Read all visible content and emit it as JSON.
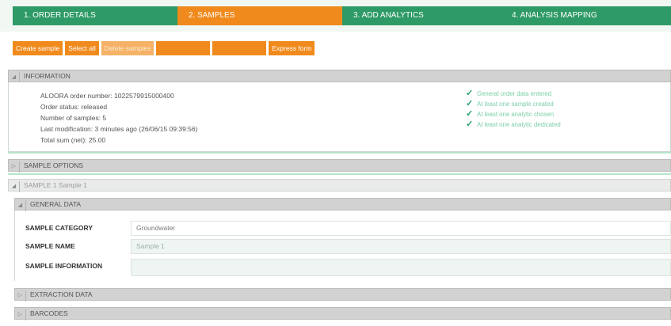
{
  "wizard": {
    "steps": [
      {
        "label": "1. ORDER DETAILS",
        "state": "done"
      },
      {
        "label": "2. SAMPLES",
        "state": "active"
      },
      {
        "label": "3. ADD ANALYTICS",
        "state": "todo"
      },
      {
        "label": "4. ANALYSIS MAPPING",
        "state": "todo"
      }
    ]
  },
  "toolbar": {
    "create": "Create sample",
    "select_all": "Select all",
    "delete": "Delete samples",
    "express": "Express form"
  },
  "information": {
    "title": "INFORMATION",
    "order_number": "ALOORA order number: 1022579915000400",
    "order_status": "Order status: released",
    "num_samples": "Number of samples: 5",
    "last_modification": "Last modification: 3 minutes ago (26/06/15 09:39:56)",
    "total_sum": "Total sum (net): 25.00",
    "checks": [
      "General order data entered",
      "At least one sample created",
      "At least one analytic chosen",
      "At least one analytic dedicated"
    ]
  },
  "sample_options": {
    "title": "SAMPLE OPTIONS"
  },
  "sample1": {
    "title": "SAMPLE 1  Sample 1"
  },
  "general_data": {
    "title": "GENERAL DATA",
    "category_label": "SAMPLE CATEGORY",
    "category_value": "Groundwater",
    "name_label": "SAMPLE NAME",
    "name_value": "Sample 1",
    "info_label": "SAMPLE INFORMATION",
    "info_value": ""
  },
  "extraction": {
    "title": "EXTRACTION DATA"
  },
  "barcodes": {
    "title": "BARCODES"
  },
  "colors": {
    "green": "#2e9a66",
    "orange": "#f08a1c"
  }
}
